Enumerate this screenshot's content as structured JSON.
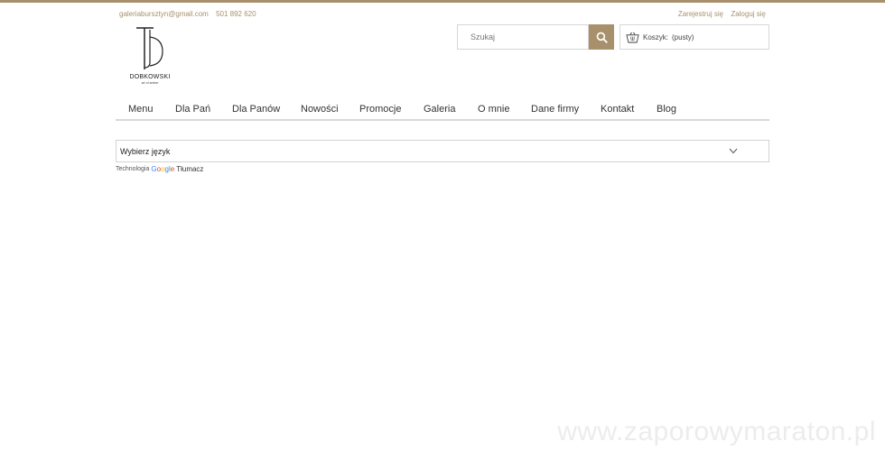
{
  "header": {
    "email": "galeriabursztyn@gmail.com",
    "phone": "501 892 620",
    "register": "Zarejestruj się",
    "login": "Zaloguj się"
  },
  "logo": {
    "name": "DOBKOWSKI",
    "tagline": "art of amber"
  },
  "search": {
    "placeholder": "Szukaj"
  },
  "cart": {
    "label": "Koszyk:",
    "status": "(pusty)"
  },
  "nav": {
    "items": [
      "Menu",
      "Dla Pań",
      "Dla Panów",
      "Nowości",
      "Promocje",
      "Galeria",
      "O mnie",
      "Dane firmy",
      "Kontakt",
      "Blog"
    ]
  },
  "language": {
    "select_label": "Wybierz język",
    "powered_by": "Technologia",
    "google": "Google",
    "translate": "Tłumacz"
  },
  "watermark": "www.zaporowymaraton.pl",
  "colors": {
    "accent": "#a8906c"
  }
}
